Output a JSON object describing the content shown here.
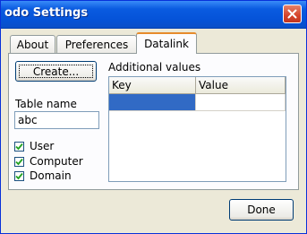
{
  "window": {
    "title": "odo Settings"
  },
  "tabs": [
    {
      "label": "About",
      "active": false
    },
    {
      "label": "Preferences",
      "active": false
    },
    {
      "label": "Datalink",
      "active": true
    }
  ],
  "datalink": {
    "create_button_label": "Create...",
    "table_name_label": "Table name",
    "table_name_value": "abc",
    "checkboxes": [
      {
        "label": "User",
        "checked": true
      },
      {
        "label": "Computer",
        "checked": true
      },
      {
        "label": "Domain",
        "checked": true
      }
    ],
    "additional_values_label": "Additional values",
    "grid": {
      "columns": [
        "Key",
        "Value"
      ],
      "rows": [
        {
          "key": "",
          "value": "",
          "selected": true
        }
      ]
    }
  },
  "footer": {
    "done_button_label": "Done"
  },
  "colors": {
    "titlebar": "#0553d8",
    "selection": "#316ac5",
    "window_bg": "#ece9d8",
    "close_button": "#d5432a"
  },
  "icons": {
    "close": "close-icon",
    "checkmark": "checkmark-icon"
  }
}
